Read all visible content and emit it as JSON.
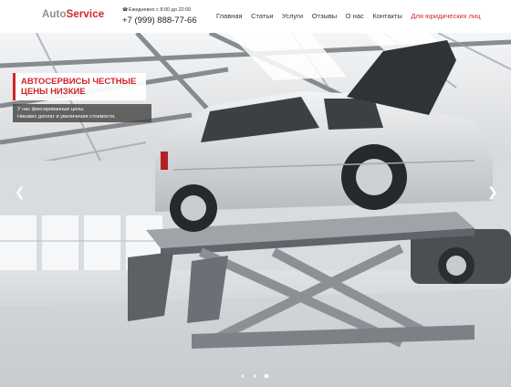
{
  "header": {
    "logo_part1": "Auto",
    "logo_part2": "Service",
    "hours": "Ежедневно с 8:00 до 22:00",
    "phone": "+7 (999) 888-77-66",
    "phone_icon": "phone-icon"
  },
  "nav": {
    "items": [
      "Главная",
      "Статьи",
      "Услуги",
      "Отзывы",
      "О нас",
      "Контакты",
      "Для юридических лиц"
    ]
  },
  "hero": {
    "title_line1": "АВТОСЕРВИСЫ ЧЕСТНЫЕ",
    "title_line2": "ЦЕНЫ НИЗКИЕ",
    "sub_line1": "У нас фиксированные цены.",
    "sub_line2": "Никаких доплат и увеличения стоимости.",
    "prev_icon": "chevron-left-icon",
    "next_icon": "chevron-right-icon",
    "slides": 3,
    "active_slide": 3
  },
  "colors": {
    "accent": "#d2232a",
    "logo_gray": "#8a8f96"
  }
}
